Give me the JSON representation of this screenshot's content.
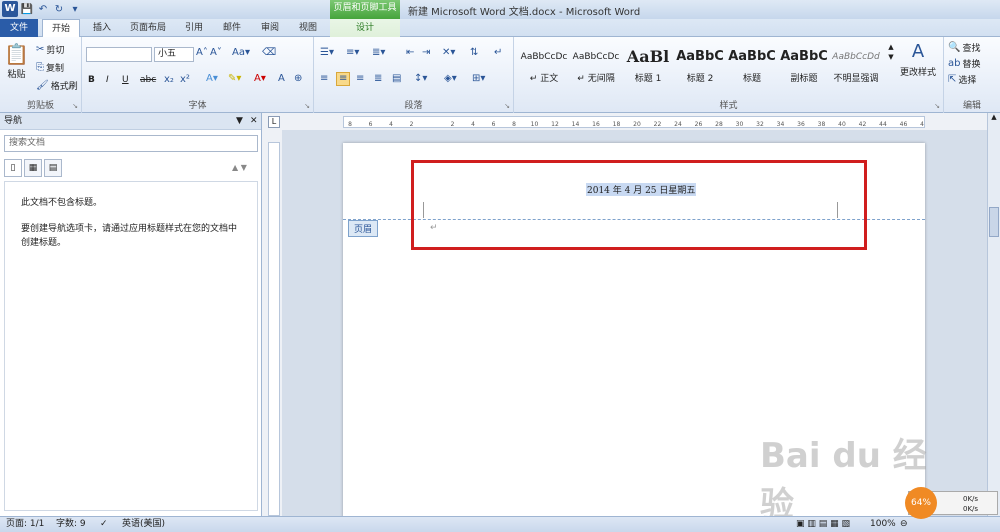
{
  "title_bar": {
    "context_tab": "页眉和页脚工具",
    "doc_title": "新建 Microsoft Word 文档.docx - Microsoft Word"
  },
  "tabs": [
    "文件",
    "开始",
    "插入",
    "页面布局",
    "引用",
    "邮件",
    "审阅",
    "视图",
    "设计"
  ],
  "ribbon": {
    "clipboard": {
      "paste": "粘贴",
      "cut": "剪切",
      "copy": "复制",
      "format_painter": "格式刷",
      "label": "剪贴板"
    },
    "font": {
      "font_name": "",
      "font_size": "小五",
      "label": "字体",
      "bold": "B",
      "italic": "I",
      "underline": "U",
      "strike": "abc"
    },
    "paragraph": {
      "label": "段落"
    },
    "styles": {
      "label": "样式",
      "items": [
        {
          "sample": "AaBbCcDc",
          "name": "↵ 正文"
        },
        {
          "sample": "AaBbCcDc",
          "name": "↵ 无间隔"
        },
        {
          "sample": "AaBl",
          "name": "标题 1"
        },
        {
          "sample": "AaBbC",
          "name": "标题 2"
        },
        {
          "sample": "AaBbC",
          "name": "标题"
        },
        {
          "sample": "AaBbC",
          "name": "副标题"
        },
        {
          "sample": "AaBbCcDd",
          "name": "不明显强调"
        }
      ],
      "change_styles": "更改样式"
    },
    "editing": {
      "find": "查找",
      "replace": "替换",
      "select": "选择",
      "label": "编辑"
    }
  },
  "nav": {
    "title": "导航",
    "search_placeholder": "搜索文档",
    "message1": "此文档不包含标题。",
    "message2": "要创建导航选项卡，请通过应用标题样式在您的文档中创建标题。"
  },
  "ruler": {
    "corner": "L",
    "ticks": [
      "8",
      "6",
      "4",
      "2",
      "",
      "2",
      "4",
      "6",
      "8",
      "10",
      "12",
      "14",
      "16",
      "18",
      "20",
      "22",
      "24",
      "26",
      "28",
      "30",
      "32",
      "34",
      "36",
      "38",
      "40",
      "42",
      "44",
      "46",
      "48"
    ]
  },
  "document": {
    "header_date": "2014 年 4 月 25 日星期五",
    "header_tag": "页眉"
  },
  "status": {
    "page": "页面: 1/1",
    "words": "字数: 9",
    "lang": "英语(美国)",
    "zoom": "100%"
  },
  "net_widget": {
    "percent": "64%",
    "up": "0K/s",
    "down": "0K/s"
  },
  "colors": {
    "accent": "#2b579a",
    "highlight_box": "#d01e1e",
    "context_green": "#46a43c"
  }
}
